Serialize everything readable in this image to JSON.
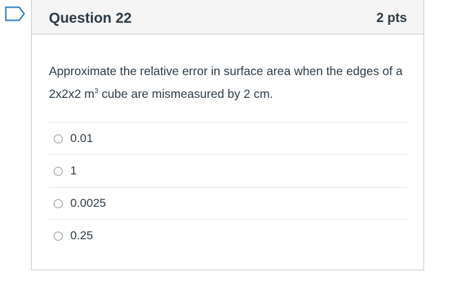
{
  "question": {
    "title": "Question 22",
    "points": "2 pts",
    "text_before": "Approximate the relative error in surface area when the edges of a 2x2x2 m",
    "superscript": "3",
    "text_after": " cube are mismeasured by 2 cm.",
    "flag_icon": "bookmark-flag-icon",
    "flag_color": "#2b7abc"
  },
  "answers": [
    {
      "label": "0.01"
    },
    {
      "label": "1"
    },
    {
      "label": "0.0025"
    },
    {
      "label": "0.25"
    }
  ],
  "colors": {
    "text": "#2d3b45",
    "header_bg": "#f5f5f5",
    "border": "#c7cdd1"
  }
}
